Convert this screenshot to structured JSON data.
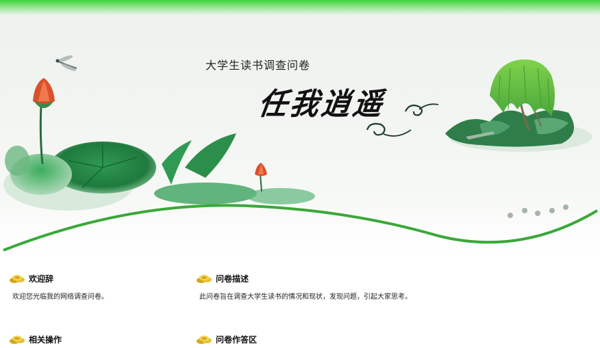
{
  "banner": {
    "subtitle": "大学生读书调查问卷",
    "calligraphy_title": "任我逍遥"
  },
  "sections": [
    {
      "title": "欢迎辞",
      "text": "欢迎您光临我的网络调查问卷。",
      "icon": "gold-coins-icon"
    },
    {
      "title": "问卷描述",
      "text": "此问卷旨在调查大学生读书的情况和现状，发现问题，引起大家思考。",
      "icon": "gold-coins-icon"
    },
    {
      "title": "相关操作",
      "icon": "gold-coins-icon"
    },
    {
      "title": "问卷作答区",
      "icon": "gold-coins-icon"
    }
  ],
  "colors": {
    "accent_green": "#3aa83a",
    "top_bar_green": "#3fd23c",
    "lotus_red": "#d9502a"
  }
}
